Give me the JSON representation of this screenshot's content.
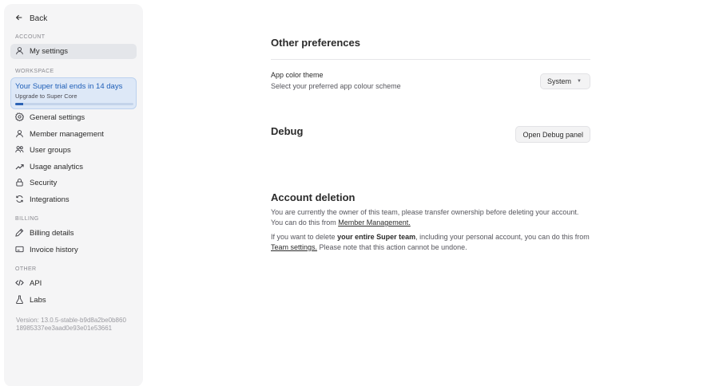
{
  "sidebar": {
    "back_label": "Back",
    "sections": {
      "account": "ACCOUNT",
      "workspace": "WORKSPACE",
      "billing": "BILLING",
      "other": "OTHER"
    },
    "account_items": [
      {
        "label": "My settings",
        "icon": "user-icon",
        "active": true
      }
    ],
    "trial": {
      "title": "Your Super trial ends in 14 days",
      "subtitle": "Upgrade to Super Core",
      "progress": 0.07
    },
    "workspace_items": [
      {
        "label": "General settings",
        "icon": "gear-icon"
      },
      {
        "label": "Member management",
        "icon": "user-icon"
      },
      {
        "label": "User groups",
        "icon": "users-icon"
      },
      {
        "label": "Usage analytics",
        "icon": "trend-icon"
      },
      {
        "label": "Security",
        "icon": "lock-icon"
      },
      {
        "label": "Integrations",
        "icon": "refresh-icon"
      }
    ],
    "billing_items": [
      {
        "label": "Billing details",
        "icon": "pen-icon"
      },
      {
        "label": "Invoice history",
        "icon": "card-icon"
      }
    ],
    "other_items": [
      {
        "label": "API",
        "icon": "code-icon"
      },
      {
        "label": "Labs",
        "icon": "flask-icon"
      }
    ],
    "version": "Version: 13.0.5-stable-b9d8a2be0b860 18985337ee3aad0e93e01e53661"
  },
  "main": {
    "other_preferences": {
      "title": "Other preferences",
      "theme_label": "App color theme",
      "theme_description": "Select your preferred app colour scheme",
      "theme_value": "System"
    },
    "debug": {
      "title": "Debug",
      "button_label": "Open Debug panel"
    },
    "account_deletion": {
      "title": "Account deletion",
      "para1_text": "You are currently the owner of this team, please transfer ownership before deleting your account. You can do this from ",
      "para1_link": "Member Management.",
      "para2_prefix": "If you want to delete ",
      "para2_bold": "your entire Super team",
      "para2_middle": ", including your personal account, you can do this from ",
      "para2_link": "Team settings.",
      "para2_suffix": " Please note that this action cannot be undone."
    }
  },
  "colors": {
    "accent": "#1f5fb8",
    "sidebar_bg": "#f5f5f6",
    "active_item_bg": "#e4e6ea",
    "trial_bg": "#dde8f7"
  }
}
